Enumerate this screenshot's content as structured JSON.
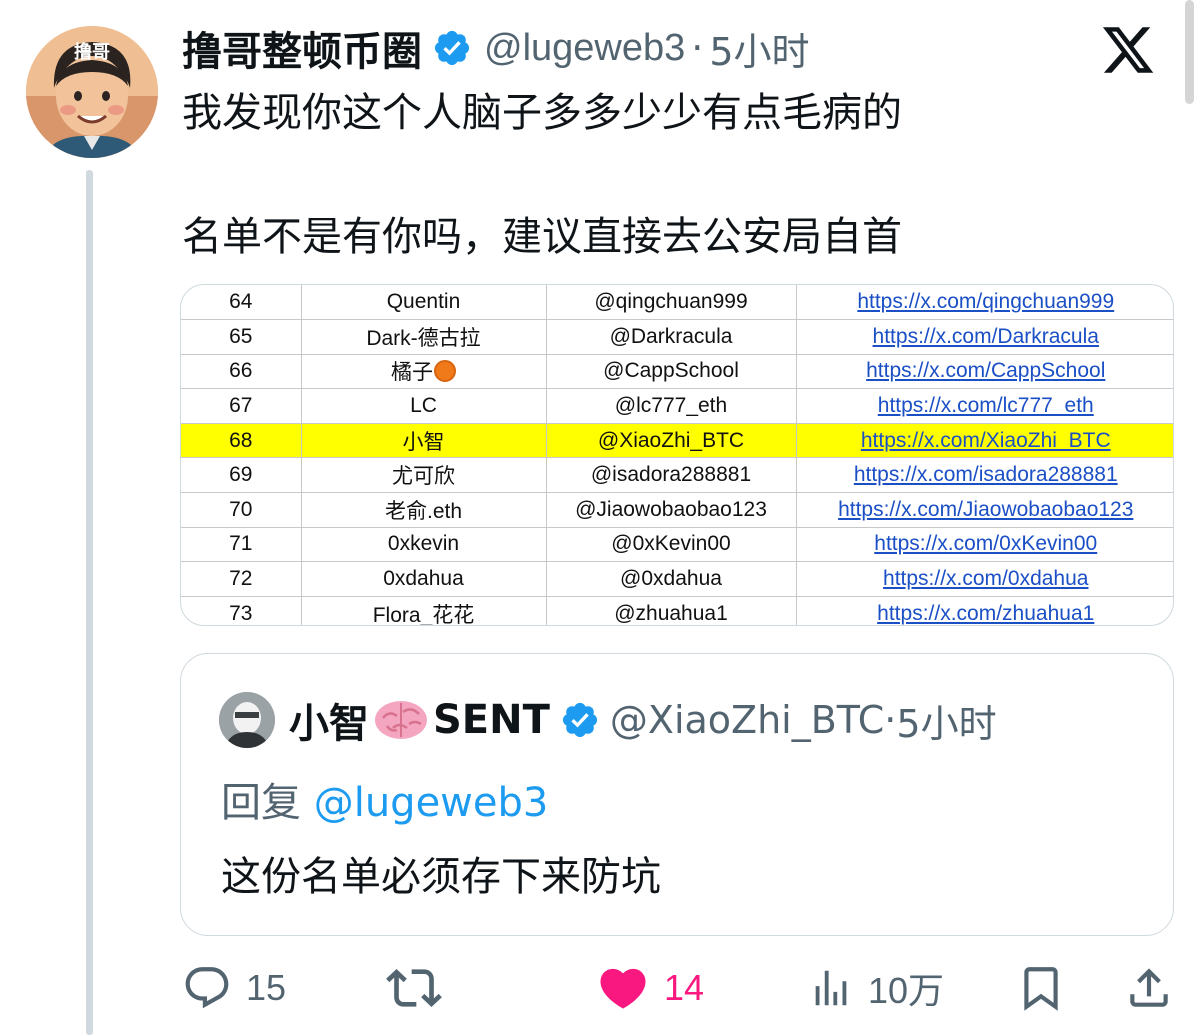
{
  "tweet": {
    "author_name": "撸哥整顿币圈",
    "author_handle": "@lugeweb3",
    "separator": "·",
    "time": "5小时",
    "text_line1": "我发现你这个人脑子多多少少有点毛病的",
    "text_line2": "名单不是有你吗，建议直接去公安局自首",
    "avatar_text": "撸哥"
  },
  "image_table": {
    "rows": [
      {
        "num": "64",
        "name": "Quentin",
        "handle": "@qingchuan999",
        "url": "https://x.com/qingchuan999"
      },
      {
        "num": "65",
        "name": "Dark-德古拉",
        "handle": "@Darkracula",
        "url": "https://x.com/Darkracula"
      },
      {
        "num": "66",
        "name": "橘子",
        "handle": "@CappSchool",
        "url": "https://x.com/CappSchool"
      },
      {
        "num": "67",
        "name": "LC",
        "handle": "@lc777_eth",
        "url": "https://x.com/lc777_eth"
      },
      {
        "num": "68",
        "name": "小智",
        "handle": "@XiaoZhi_BTC",
        "url": "https://x.com/XiaoZhi_BTC"
      },
      {
        "num": "69",
        "name": "尤可欣",
        "handle": "@isadora288881",
        "url": "https://x.com/isadora288881"
      },
      {
        "num": "70",
        "name": "老俞.eth",
        "handle": "@Jiaowobaobao123",
        "url": "https://x.com/Jiaowobaobao123"
      },
      {
        "num": "71",
        "name": "0xkevin",
        "handle": "@0xKevin00",
        "url": "https://x.com/0xKevin00"
      },
      {
        "num": "72",
        "name": "0xdahua",
        "handle": "@0xdahua",
        "url": "https://x.com/0xdahua"
      },
      {
        "num": "73",
        "name": "Flora_花花",
        "handle": "@zhuahua1",
        "url": "https://x.com/zhuahua1"
      }
    ],
    "highlight_color": "#ffff00",
    "link_color": "#1a4fc6"
  },
  "quote": {
    "author_name": "小智",
    "author_suffix": "SENT",
    "author_handle": "@XiaoZhi_BTC",
    "separator": "·",
    "time": "5小时",
    "reply_prefix": "回复",
    "reply_mention": "@lugeweb3",
    "text": "这份名单必须存下来防坑"
  },
  "actions": {
    "replies": "15",
    "likes": "14",
    "views": "10万"
  },
  "colors": {
    "verified": "#1d9bf0",
    "like": "#f91880",
    "muted": "#536471"
  }
}
